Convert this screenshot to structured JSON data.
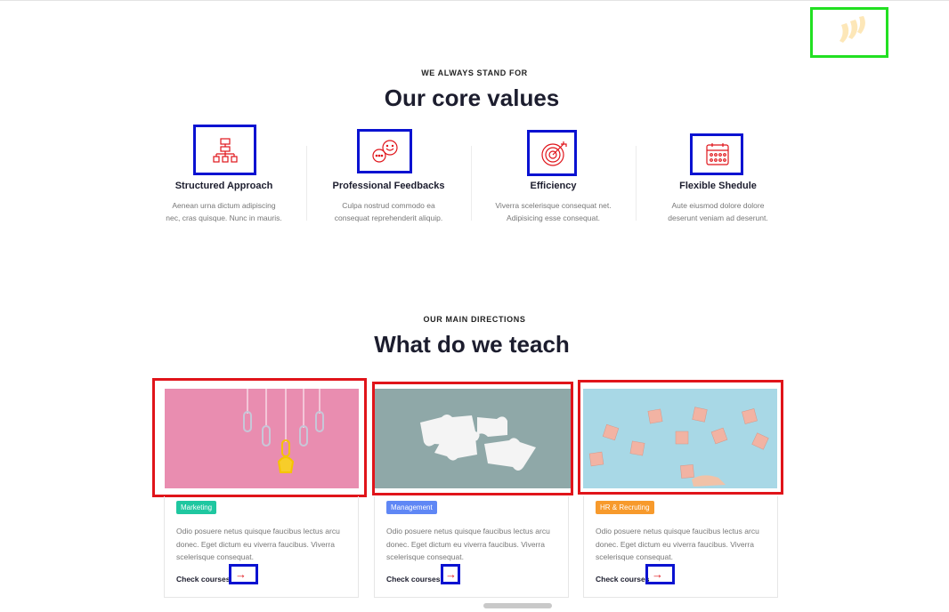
{
  "values_section": {
    "eyebrow": "WE ALWAYS STAND FOR",
    "title": "Our core values",
    "items": [
      {
        "icon": "structure-icon",
        "title": "Structured Approach",
        "desc1": "Aenean urna dictum adipiscing",
        "desc2": "nec, cras quisque. Nunc in mauris."
      },
      {
        "icon": "chat-bubbles-icon",
        "title": "Professional Feedbacks",
        "desc1": "Culpa nostrud commodo ea",
        "desc2": "consequat reprehenderit aliquip."
      },
      {
        "icon": "target-icon",
        "title": "Efficiency",
        "desc1": "Viverra scelerisque consequat net.",
        "desc2": "Adipisicing esse consequat."
      },
      {
        "icon": "calendar-icon",
        "title": "Flexible Shedule",
        "desc1": "Aute eiusmod dolore dolore",
        "desc2": "deserunt veniam ad deserunt."
      }
    ]
  },
  "teach_section": {
    "eyebrow": "OUR MAIN DIRECTIONS",
    "title": "What do we teach",
    "cards": [
      {
        "image": "lightbulb-paperclips-image",
        "tag": "Marketing",
        "tag_color": "#1fc7a0",
        "desc": "Odio posuere netus quisque faucibus lectus arcu donec. Eget dictum eu viverra faucibus. Viverra scelerisque consequat.",
        "link": "Check courses",
        "arrow": "→"
      },
      {
        "image": "puzzle-pieces-image",
        "tag": "Management",
        "tag_color": "#5f87f5",
        "desc": "Odio posuere netus quisque faucibus lectus arcu donec. Eget dictum eu viverra faucibus. Viverra scelerisque consequat.",
        "link": "Check courses",
        "arrow": "→"
      },
      {
        "image": "people-blocks-image",
        "tag": "HR & Recruting",
        "tag_color": "#f79a2c",
        "desc": "Odio posuere netus quisque faucibus lectus arcu donec. Eget dictum eu viverra faucibus. Viverra scelerisque consequat.",
        "link": "Check courses",
        "arrow": "→"
      }
    ]
  },
  "colors": {
    "accent": "#e0141a",
    "annotation_blue": "#0a12d1",
    "annotation_green": "#22e022"
  }
}
